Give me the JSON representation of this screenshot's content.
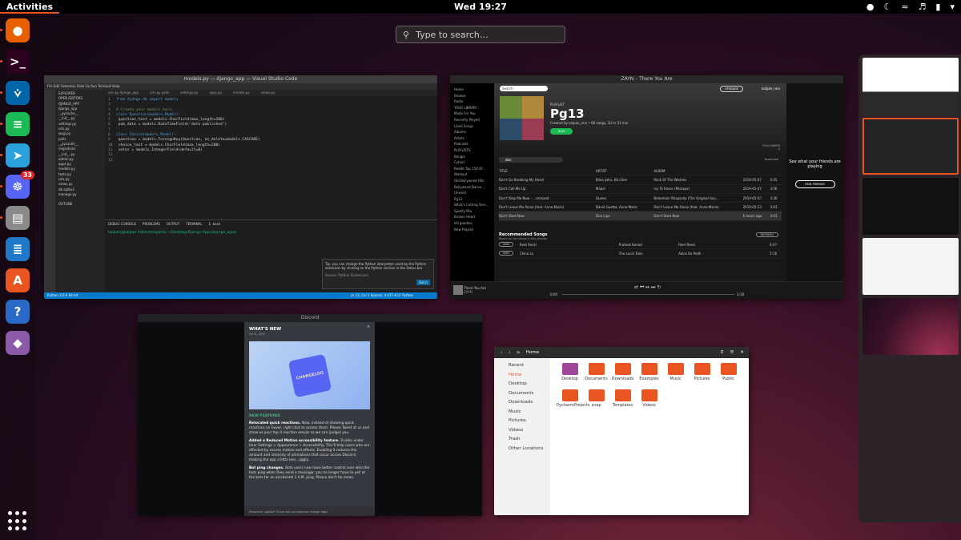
{
  "topbar": {
    "activities": "Activities",
    "clock": "Wed 19:27"
  },
  "dock": {
    "apps": [
      {
        "name": "Firefox",
        "icon": "firefox-icon",
        "color": "#e66000",
        "glyph": "●"
      },
      {
        "name": "Terminal",
        "icon": "terminal-icon",
        "color": "#2c001e",
        "glyph": ">_"
      },
      {
        "name": "Visual Studio Code",
        "icon": "vscode-icon",
        "color": "#0065a9",
        "glyph": "⩒"
      },
      {
        "name": "Spotify",
        "icon": "spotify-icon",
        "color": "#1db954",
        "glyph": "≡"
      },
      {
        "name": "Telegram",
        "icon": "telegram-icon",
        "color": "#2aa1da",
        "glyph": "➤"
      },
      {
        "name": "Discord",
        "icon": "discord-icon",
        "color": "#5865f2",
        "glyph": "☸",
        "badge": "33"
      },
      {
        "name": "Files",
        "icon": "files-icon",
        "color": "#8a8a8a",
        "glyph": "▤"
      },
      {
        "name": "LibreOffice Writer",
        "icon": "writer-icon",
        "color": "#1f78c8",
        "glyph": "≣"
      },
      {
        "name": "Ubuntu Software",
        "icon": "software-icon",
        "color": "#e95420",
        "glyph": "A"
      },
      {
        "name": "Help",
        "icon": "help-icon",
        "color": "#2a6ac7",
        "glyph": "?"
      },
      {
        "name": "App",
        "icon": "diamond-app-icon",
        "color": "#8c5ba8",
        "glyph": "◆"
      }
    ]
  },
  "search": {
    "placeholder": "Type to search…"
  },
  "vscode": {
    "title": "models.py — django_app — Visual Studio Code",
    "menu": "File  Edit  Selection  View  Go  Run  Terminal  Help",
    "explorer": "EXPLORER",
    "open_editors": "OPEN EDITORS",
    "tabs": [
      "urls.py django_app",
      "urls.py polls",
      "settings.py",
      "apps.py",
      "models.py",
      "views.py"
    ],
    "files": [
      "DJANGO_APP",
      "django_app",
      "__pycache__",
      "__init__.py",
      "settings.py",
      "urls.py",
      "wsgi.py",
      "polls",
      "__pycache__",
      "migrations",
      "__init__.py",
      "admin.py",
      "apps.py",
      "models.py",
      "tests.py",
      "urls.py",
      "views.py",
      "db.sqlite3",
      "manage.py"
    ],
    "code": [
      {
        "n": "1",
        "t": "from django.db import models"
      },
      {
        "n": "2",
        "t": ""
      },
      {
        "n": "3",
        "t": "# Create your models here."
      },
      {
        "n": "4",
        "t": "class Question(models.Model):"
      },
      {
        "n": "5",
        "t": "    question_text = models.CharField(max_length=200)"
      },
      {
        "n": "6",
        "t": "    pub_date = models.DateTimeField('date published')"
      },
      {
        "n": "7",
        "t": ""
      },
      {
        "n": "8",
        "t": "class Choice(models.Model):"
      },
      {
        "n": "9",
        "t": "    question = models.ForeignKey(Question, on_delete=models.CASCADE)"
      },
      {
        "n": "10",
        "t": "    choice_text = models.CharField(max_length=200)"
      },
      {
        "n": "11",
        "t": "    votes = models.IntegerField(default=0)"
      },
      {
        "n": "12",
        "t": ""
      },
      {
        "n": "13",
        "t": ""
      }
    ],
    "terminal_tabs": [
      "DEBUG CONSOLE",
      "PROBLEMS",
      "OUTPUT",
      "TERMINAL"
    ],
    "terminal_select": "1: bash",
    "terminal_line": "kalpan@kalpan-sabnotmayahai:~/Desktop/Django-Apps/django_app$",
    "notification": "Tip: you can change the Python interpreter used by the Python extension by clicking on the Python version in the status bar",
    "notification_source": "Source: Python (Extension)",
    "notification_btn": "Got it",
    "status": "Python 3.6.9 64-bit",
    "status_right": "Ln 13, Col 1   Spaces: 4   UTF-8   LF   Python",
    "outline": "OUTLINE"
  },
  "spotify": {
    "title": "ZAYN – There You Are",
    "nav": [
      "Home",
      "Browse",
      "Radio"
    ],
    "library_label": "YOUR LIBRARY",
    "library": [
      "Made For You",
      "Recently Played",
      "Liked Songs",
      "Albums",
      "Artists",
      "Podcasts"
    ],
    "playlists_label": "PLAYLISTS",
    "playlists": [
      "Bangla",
      "Cyfnel",
      "Reddit Top 150 Of...",
      "Workout",
      "Old Bollywood Hits",
      "Bollywood Dance ...",
      "Unwind",
      "Pg13",
      "What's Cutting Ove...",
      "Spotify Mix",
      "Broken Heart",
      "kill goodies"
    ],
    "new_playlist": "New Playlist",
    "search_placeholder": "Search",
    "upgrade": "UPGRADE",
    "user": "kalpan_nnn",
    "playlist_tag": "PLAYLIST",
    "playlist_name": "Pg13",
    "playlist_meta": "Created by kalpan_nnn • 66 songs, 10 hr 31 min",
    "play": "PLAY",
    "followers_label": "FOLLOWERS",
    "followers": "0",
    "filter": "don",
    "download": "Download",
    "columns": [
      "TITLE",
      "ARTIST",
      "ALBUM",
      "",
      ""
    ],
    "tracks": [
      [
        "Don't Go Breaking My Heart",
        "Elton John, Kiki Dee",
        "Rock Of The Westies",
        "2019-05-07",
        "4:35"
      ],
      [
        "Don't Call Me Up",
        "Mabel",
        "Ivy To Roses (Mixtape)",
        "2019-05-07",
        "3:56"
      ],
      [
        "Don't Stop Me Now - ...remixed",
        "Queen",
        "Bohemian Rhapsody (The Original Sou...",
        "2019-05-07",
        "3:36"
      ],
      [
        "Don't Leave Me Alone (feat. Anne-Marie)",
        "David Guetta, Anne-Marie",
        "Don't Leave Me Alone (feat. Anne-Marie)",
        "2019-05-23",
        "3:03"
      ],
      [
        "Don't Start Now",
        "Dua Lipa",
        "Don't Start Now",
        "6 hours ago",
        "3:03"
      ]
    ],
    "rec_title": "Recommended Songs",
    "rec_sub": "Based on the songs in this playlist",
    "refresh": "REFRESH",
    "rec": [
      [
        "ADD",
        "Reet Reezi",
        "Prateek Kuhad",
        "Reet Reezi",
        "4:47"
      ],
      [
        "ADD",
        "China Lo",
        "The Local Train",
        "Aalas Ka Pedh",
        "5:16"
      ]
    ],
    "friends_text": "See what your friends are playing",
    "find_friends": "FIND FRIENDS",
    "now_playing": "There You Are",
    "now_artist": "ZAYN",
    "time_start": "0:00",
    "time_end": "3:18"
  },
  "discord": {
    "title": "Discord",
    "modal_title": "WHAT'S NEW",
    "modal_date": "Apr 6, 2020",
    "art_text": "CHANGELOG",
    "section": "NEW FEATURES",
    "items": [
      {
        "b": "Relocated quick reactions.",
        "t": "Now, instead of showing quick reactions on hover, right click to access them. Please Tweet at us and show us your top 4 reaction emojis so we can (judge) you."
      },
      {
        "b": "Added a Reduced Motion accessibility feature.",
        "t": "Enable under User Settings > Appearance > Accessibility. This'll help users who are affected by excess motion and effects. Enabling it reduces the amount and intensity of animations that occur across Discord, making the app a little less...jiggly."
      },
      {
        "b": "Bot ping changes.",
        "t": "Bots users now have better control over who the bots ping when they send a message: you no longer have to yell at the bots for an accidental 2 A.M. ping. Please don't be mean."
      }
    ],
    "footer": "Missed an update? Check out our previous change logs!"
  },
  "files": {
    "location": "Home",
    "sidebar": [
      "Recent",
      "Home",
      "Desktop",
      "Documents",
      "Downloads",
      "Music",
      "Pictures",
      "Videos",
      "Trash",
      "Other Locations"
    ],
    "folders": [
      "Desktop",
      "Documents",
      "Downloads",
      "Examples",
      "Music",
      "Pictures",
      "Public",
      "PycharmProjects",
      "snap",
      "Templates",
      "Videos"
    ]
  },
  "colors": {
    "accent": "#e95420",
    "spotify_green": "#1db954",
    "vscode_blue": "#007acc"
  }
}
